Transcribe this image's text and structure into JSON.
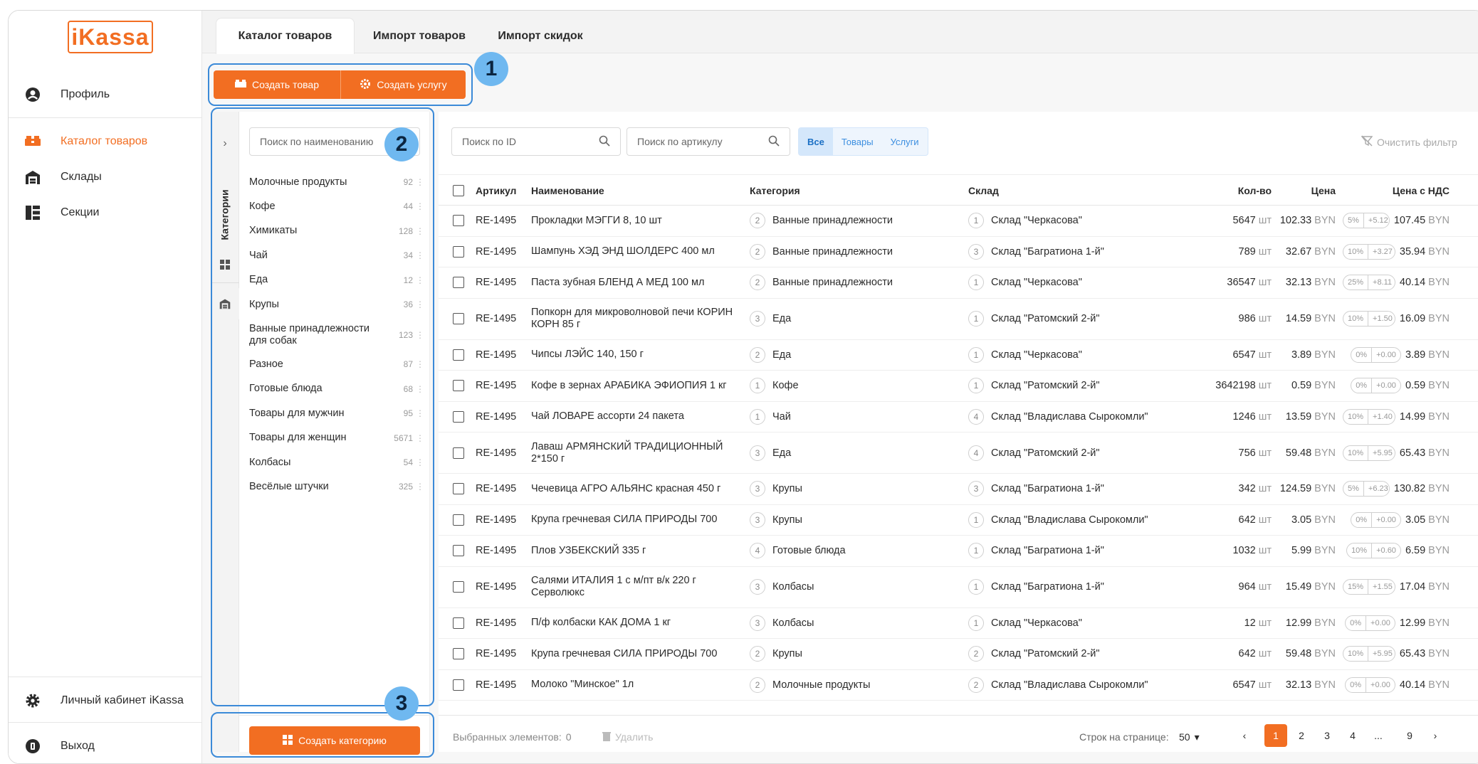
{
  "sidebar": {
    "logo": "iKassa",
    "items": [
      {
        "label": "Профиль",
        "icon": "user-circle-icon"
      },
      {
        "label": "Каталог товаров",
        "icon": "boxes-icon",
        "active": true
      },
      {
        "label": "Склады",
        "icon": "warehouse-icon"
      },
      {
        "label": "Секции",
        "icon": "sections-icon"
      }
    ],
    "bottom": [
      {
        "label": "Личный кабинет iKassa",
        "icon": "gear-icon"
      },
      {
        "label": "Выход",
        "icon": "logout-icon"
      }
    ]
  },
  "tabs": [
    "Каталог товаров",
    "Импорт товаров",
    "Импорт скидок"
  ],
  "toolbar": {
    "create_product": "Создать товар",
    "create_service": "Создать услугу"
  },
  "callouts": [
    "1",
    "2",
    "3"
  ],
  "categories": {
    "vertical_tab": "Категории",
    "search_placeholder": "Поиск по наименованию",
    "items": [
      {
        "name": "Молочные продукты",
        "count": "92"
      },
      {
        "name": "Кофе",
        "count": "44"
      },
      {
        "name": "Химикаты",
        "count": "128"
      },
      {
        "name": "Чай",
        "count": "34"
      },
      {
        "name": "Еда",
        "count": "12"
      },
      {
        "name": "Крупы",
        "count": "36"
      },
      {
        "name": "Ванные принадлежности для собак",
        "count": "123"
      },
      {
        "name": "Разное",
        "count": "87"
      },
      {
        "name": "Готовые блюда",
        "count": "68"
      },
      {
        "name": "Товары для мужчин",
        "count": "95"
      },
      {
        "name": "Товары для женщин",
        "count": "5671"
      },
      {
        "name": "Колбасы",
        "count": "54"
      },
      {
        "name": "Весёлые штучки",
        "count": "325"
      }
    ],
    "create_button": "Создать категорию"
  },
  "filters": {
    "search_id": "Поиск по ID",
    "search_article": "Поиск по артикулу",
    "segments": [
      "Все",
      "Товары",
      "Услуги"
    ],
    "clear": "Очистить фильтр"
  },
  "table": {
    "headers": [
      "Артикул",
      "Наименование",
      "Категория",
      "Склад",
      "Кол-во",
      "Цена",
      "Цена с НДС"
    ],
    "unit": "шт",
    "currency": "BYN",
    "rows": [
      {
        "sku": "RE-1495",
        "name": "Прокладки МЭГГИ 8, 10 шт",
        "cat_n": "2",
        "cat": "Ванные принадлежности",
        "wh_n": "1",
        "wh": "Склад \"Черкасова\"",
        "qty": "5647",
        "price": "102.33",
        "vat": "5%",
        "vat_amt": "+5.12",
        "total": "107.45"
      },
      {
        "sku": "RE-1495",
        "name": "Шампунь ХЭД ЭНД ШОЛДЕРС 400 мл",
        "cat_n": "2",
        "cat": "Ванные принадлежности",
        "wh_n": "3",
        "wh": "Склад \"Багратиона 1-й\"",
        "qty": "789",
        "price": "32.67",
        "vat": "10%",
        "vat_amt": "+3.27",
        "total": "35.94"
      },
      {
        "sku": "RE-1495",
        "name": "Паста зубная БЛЕНД А МЕД 100 мл",
        "cat_n": "2",
        "cat": "Ванные принадлежности",
        "wh_n": "1",
        "wh": "Склад \"Черкасова\"",
        "qty": "36547",
        "price": "32.13",
        "vat": "25%",
        "vat_amt": "+8.11",
        "total": "40.14"
      },
      {
        "sku": "RE-1495",
        "name": "Попкорн для микроволновой печи КОРИН КОРН 85 г",
        "cat_n": "3",
        "cat": "Еда",
        "wh_n": "1",
        "wh": "Склад \"Ратомский 2-й\"",
        "qty": "986",
        "price": "14.59",
        "vat": "10%",
        "vat_amt": "+1.50",
        "total": "16.09",
        "tall": true
      },
      {
        "sku": "RE-1495",
        "name": "Чипсы ЛЭЙС 140, 150 г",
        "cat_n": "2",
        "cat": "Еда",
        "wh_n": "1",
        "wh": "Склад \"Черкасова\"",
        "qty": "6547",
        "price": "3.89",
        "vat": "0%",
        "vat_amt": "+0.00",
        "total": "3.89"
      },
      {
        "sku": "RE-1495",
        "name": "Кофе в зернах АРАБИКА ЭФИОПИЯ 1 кг",
        "cat_n": "1",
        "cat": "Кофе",
        "wh_n": "1",
        "wh": "Склад \"Ратомский 2-й\"",
        "qty": "3642198",
        "price": "0.59",
        "vat": "0%",
        "vat_amt": "+0.00",
        "total": "0.59"
      },
      {
        "sku": "RE-1495",
        "name": "Чай ЛОВАРЕ ассорти 24 пакета",
        "cat_n": "1",
        "cat": "Чай",
        "wh_n": "4",
        "wh": "Склад \"Владислава Сырокомли\"",
        "qty": "1246",
        "price": "13.59",
        "vat": "10%",
        "vat_amt": "+1.40",
        "total": "14.99"
      },
      {
        "sku": "RE-1495",
        "name": "Лаваш АРМЯНСКИЙ ТРАДИЦИОННЫЙ 2*150 г",
        "cat_n": "3",
        "cat": "Еда",
        "wh_n": "4",
        "wh": "Склад \"Ратомский 2-й\"",
        "qty": "756",
        "price": "59.48",
        "vat": "10%",
        "vat_amt": "+5.95",
        "total": "65.43",
        "tall": true
      },
      {
        "sku": "RE-1495",
        "name": "Чечевица АГРО АЛЬЯНС красная 450 г",
        "cat_n": "3",
        "cat": "Крупы",
        "wh_n": "3",
        "wh": "Склад \"Багратиона 1-й\"",
        "qty": "342",
        "price": "124.59",
        "vat": "5%",
        "vat_amt": "+6.23",
        "total": "130.82"
      },
      {
        "sku": "RE-1495",
        "name": "Крупа гречневая СИЛА ПРИРОДЫ 700",
        "cat_n": "3",
        "cat": "Крупы",
        "wh_n": "1",
        "wh": "Склад \"Владислава Сырокомли\"",
        "qty": "642",
        "price": "3.05",
        "vat": "0%",
        "vat_amt": "+0.00",
        "total": "3.05"
      },
      {
        "sku": "RE-1495",
        "name": "Плов УЗБЕКСКИЙ 335 г",
        "cat_n": "4",
        "cat": "Готовые блюда",
        "wh_n": "1",
        "wh": "Склад \"Багратиона 1-й\"",
        "qty": "1032",
        "price": "5.99",
        "vat": "10%",
        "vat_amt": "+0.60",
        "total": "6.59"
      },
      {
        "sku": "RE-1495",
        "name": "Салями ИТАЛИЯ 1 с м/пт в/к 220 г Серволюкс",
        "cat_n": "3",
        "cat": "Колбасы",
        "wh_n": "1",
        "wh": "Склад \"Багратиона 1-й\"",
        "qty": "964",
        "price": "15.49",
        "vat": "15%",
        "vat_amt": "+1.55",
        "total": "17.04",
        "tall": true
      },
      {
        "sku": "RE-1495",
        "name": "П/ф колбаски КАК ДОМА 1 кг",
        "cat_n": "3",
        "cat": "Колбасы",
        "wh_n": "1",
        "wh": "Склад \"Черкасова\"",
        "qty": "12",
        "price": "12.99",
        "vat": "0%",
        "vat_amt": "+0.00",
        "total": "12.99"
      },
      {
        "sku": "RE-1495",
        "name": "Крупа гречневая СИЛА ПРИРОДЫ 700",
        "cat_n": "2",
        "cat": "Крупы",
        "wh_n": "2",
        "wh": "Склад \"Ратомский 2-й\"",
        "qty": "642",
        "price": "59.48",
        "vat": "10%",
        "vat_amt": "+5.95",
        "total": "65.43"
      },
      {
        "sku": "RE-1495",
        "name": "Молоко \"Минское\" 1л",
        "cat_n": "2",
        "cat": "Молочные продукты",
        "wh_n": "2",
        "wh": "Склад \"Владислава Сырокомли\"",
        "qty": "6547",
        "price": "32.13",
        "vat": "0%",
        "vat_amt": "+0.00",
        "total": "40.14"
      }
    ]
  },
  "footer": {
    "selected_label": "Выбранных элементов:",
    "selected_count": "0",
    "delete": "Удалить",
    "rows_per_page_label": "Строк на странице:",
    "rows_per_page": "50",
    "pages": [
      "1",
      "2",
      "3",
      "4",
      "...",
      "9"
    ],
    "prev": "‹",
    "next": "›"
  },
  "colors": {
    "accent": "#f26e22",
    "callout": "#3b8ad8",
    "badge": "#6fb8f0"
  }
}
